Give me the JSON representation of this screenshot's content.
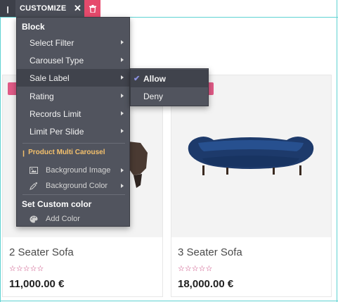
{
  "toolbar": {
    "handle_glyph": "ꞁ",
    "title": "CUSTOMIZE",
    "close_glyph": "✕"
  },
  "menu": {
    "block_heading": "Block",
    "items": [
      {
        "label": "Select Filter"
      },
      {
        "label": "Carousel Type"
      },
      {
        "label": "Sale Label"
      },
      {
        "label": "Rating"
      },
      {
        "label": "Records Limit"
      },
      {
        "label": "Limit Per Slide"
      }
    ],
    "snippet_name": "Product Multi Carousel",
    "background_options": [
      {
        "label": "Background Image",
        "icon": "image-icon"
      },
      {
        "label": "Background Color",
        "icon": "eyedropper-icon"
      }
    ],
    "custom_color_heading": "Set Custom color",
    "add_color": {
      "label": "Add Color",
      "icon": "palette-icon"
    }
  },
  "submenu": {
    "options": [
      {
        "label": "Allow",
        "selected": true
      },
      {
        "label": "Deny",
        "selected": false
      }
    ]
  },
  "products": [
    {
      "name": "2 Seater Sofa",
      "rating_stars": "☆☆☆☆☆",
      "price": "11,000.00 €"
    },
    {
      "name": "3 Seater Sofa",
      "rating_stars": "☆☆☆☆☆",
      "price": "18,000.00 €"
    }
  ],
  "colors": {
    "accent_delete": "#e64a6c",
    "menu_bg": "#51545e",
    "sale_tag": "#e05a86",
    "star": "#c43a74",
    "snippet_label": "#f5c16c"
  }
}
